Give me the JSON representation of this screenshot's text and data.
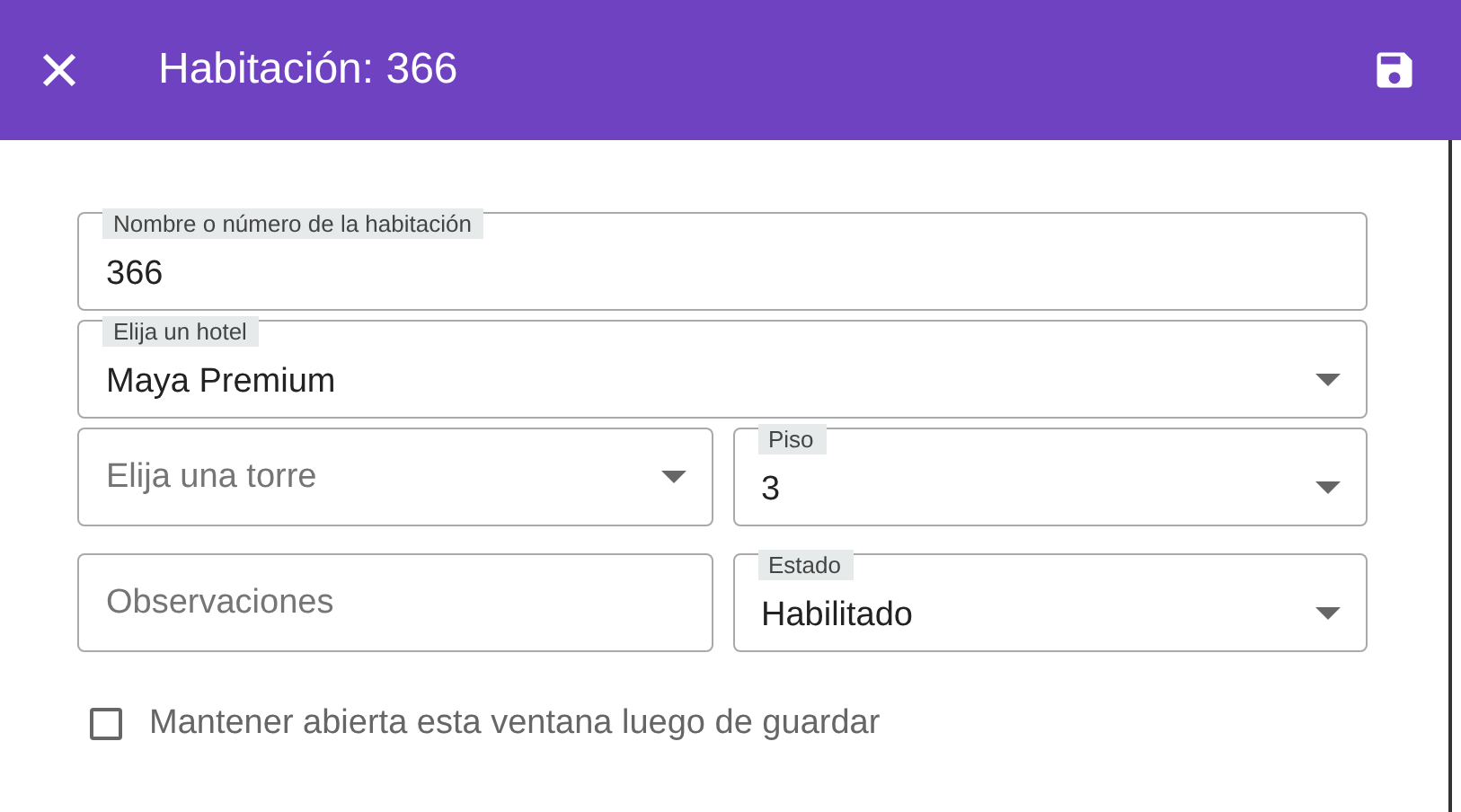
{
  "header": {
    "title": "Habitación: 366"
  },
  "rows": [
    [
      {
        "kind": "text",
        "label": "Nombre o número de la habitación",
        "value": "366"
      }
    ],
    [
      {
        "kind": "select",
        "label": "Elija un hotel",
        "value": "Maya Premium"
      }
    ],
    [
      {
        "kind": "select",
        "placeholder": "Elija una torre"
      },
      {
        "kind": "select",
        "label": "Piso",
        "value": "3"
      }
    ],
    [
      {
        "kind": "text",
        "placeholder": "Observaciones"
      },
      {
        "kind": "select",
        "label": "Estado",
        "value": "Habilitado"
      }
    ]
  ],
  "keep_open": {
    "label": "Mantener abierta esta ventana luego de guardar",
    "checked": false
  }
}
